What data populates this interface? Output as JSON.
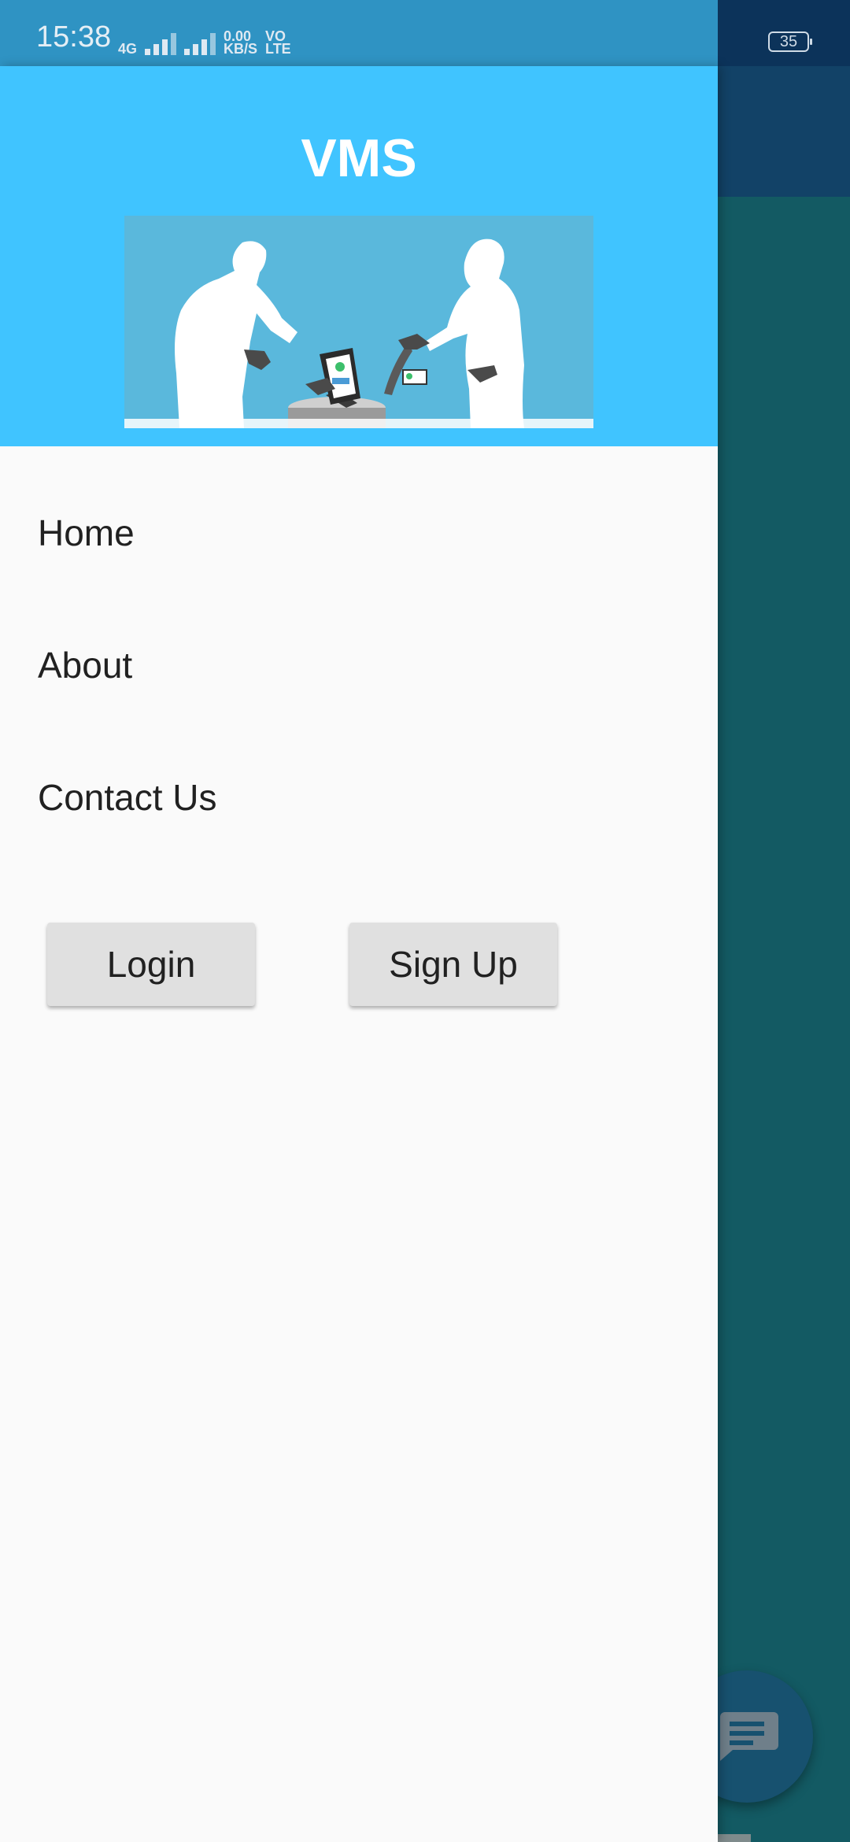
{
  "status_bar": {
    "time": "15:38",
    "network_label": "4G",
    "speed_value": "0.00",
    "speed_unit": "KB/S",
    "volte_top": "VO",
    "volte_bottom": "LTE",
    "battery": "35"
  },
  "drawer": {
    "title": "VMS",
    "header_image_icon": "visitor-checkin-illustration",
    "menu": [
      {
        "label": "Home"
      },
      {
        "label": "About"
      },
      {
        "label": "Contact Us"
      }
    ],
    "buttons": {
      "login": "Login",
      "signup": "Sign Up"
    }
  },
  "background": {
    "fab_icon": "chat-icon"
  },
  "colors": {
    "drawer_header": "#40c4ff",
    "drawer_bg": "#fafafa",
    "button_bg": "#e0e0e0",
    "app_bar": "#124267",
    "app_body": "#135a63"
  }
}
